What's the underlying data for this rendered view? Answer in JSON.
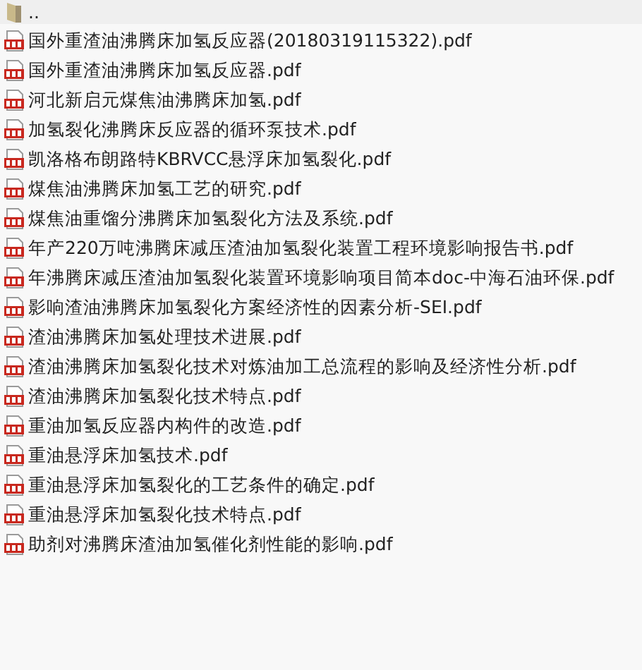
{
  "files": [
    {
      "kind": "folder",
      "name": ".."
    },
    {
      "kind": "pdf",
      "name": "国外重渣油沸腾床加氢反应器(20180319115322).pdf"
    },
    {
      "kind": "pdf",
      "name": "国外重渣油沸腾床加氢反应器.pdf"
    },
    {
      "kind": "pdf",
      "name": "河北新启元煤焦油沸腾床加氢.pdf"
    },
    {
      "kind": "pdf",
      "name": "加氢裂化沸腾床反应器的循环泵技术.pdf"
    },
    {
      "kind": "pdf",
      "name": "凯洛格布朗路特KBRVCC悬浮床加氢裂化.pdf"
    },
    {
      "kind": "pdf",
      "name": "煤焦油沸腾床加氢工艺的研究.pdf"
    },
    {
      "kind": "pdf",
      "name": "煤焦油重馏分沸腾床加氢裂化方法及系统.pdf"
    },
    {
      "kind": "pdf",
      "name": "年产220万吨沸腾床减压渣油加氢裂化装置工程环境影响报告书.pdf"
    },
    {
      "kind": "pdf",
      "name": "年沸腾床减压渣油加氢裂化装置环境影响项目简本doc-中海石油环保.pdf"
    },
    {
      "kind": "pdf",
      "name": "影响渣油沸腾床加氢裂化方案经济性的因素分析-SEI.pdf"
    },
    {
      "kind": "pdf",
      "name": "渣油沸腾床加氢处理技术进展.pdf"
    },
    {
      "kind": "pdf",
      "name": "渣油沸腾床加氢裂化技术对炼油加工总流程的影响及经济性分析.pdf"
    },
    {
      "kind": "pdf",
      "name": "渣油沸腾床加氢裂化技术特点.pdf"
    },
    {
      "kind": "pdf",
      "name": "重油加氢反应器内构件的改造.pdf"
    },
    {
      "kind": "pdf",
      "name": "重油悬浮床加氢技术.pdf"
    },
    {
      "kind": "pdf",
      "name": "重油悬浮床加氢裂化的工艺条件的确定.pdf"
    },
    {
      "kind": "pdf",
      "name": "重油悬浮床加氢裂化技术特点.pdf"
    },
    {
      "kind": "pdf",
      "name": "助剂对沸腾床渣油加氢催化剂性能的影响.pdf"
    }
  ]
}
